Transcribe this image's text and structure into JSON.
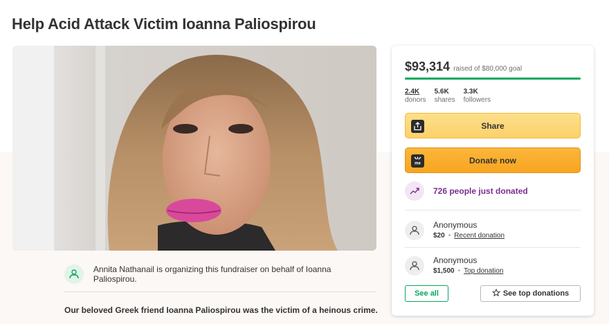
{
  "page": {
    "title": "Help Acid Attack Victim Ioanna Paliospirou"
  },
  "organizer": {
    "text": "Annita Nathanail is organizing this fundraiser on behalf of Ioanna Paliospirou."
  },
  "story": {
    "first_line": "Our beloved Greek friend Ioanna Paliospirou was the victim of a heinous crime."
  },
  "sidebar": {
    "amount": "$93,314",
    "goal_text": "raised of $80,000 goal",
    "progress_fraction": 1.0,
    "progress_color": "#02a95c",
    "stats": [
      {
        "value": "2.4K",
        "label": "donors"
      },
      {
        "value": "5.6K",
        "label": "shares"
      },
      {
        "value": "3.3K",
        "label": "followers"
      }
    ],
    "share_label": "Share",
    "donate_label": "Donate now",
    "donate_icon_text": "me",
    "trend_text": "726 people just donated",
    "donations": [
      {
        "name": "Anonymous",
        "amount": "$20",
        "tag": "Recent donation"
      },
      {
        "name": "Anonymous",
        "amount": "$1,500",
        "tag": "Top donation"
      }
    ],
    "see_all_label": "See all",
    "see_top_label": "See top donations"
  },
  "icons": {
    "share": "share-icon",
    "donate": "donate-logo-icon",
    "trend": "trending-up-icon",
    "user": "user-heart-icon",
    "star": "star-icon"
  }
}
